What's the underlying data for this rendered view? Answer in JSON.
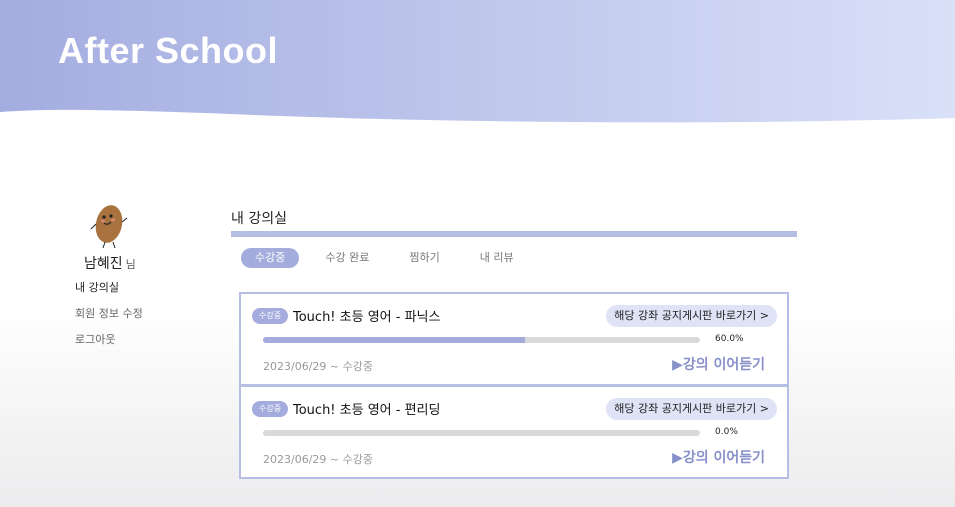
{
  "header": {
    "brand": "After School",
    "gradient_from": "#a4ade0",
    "gradient_to": "#d9e0f8"
  },
  "sidebar": {
    "avatar_icon": "potato-character-icon",
    "user_name": "남혜진",
    "user_suffix": "님",
    "menu": [
      {
        "label": "내 강의실",
        "active": true
      },
      {
        "label": "회원 정보 수정",
        "active": false
      },
      {
        "label": "로그아웃",
        "active": false
      }
    ]
  },
  "main": {
    "title": "내 강의실",
    "tabs": [
      {
        "label": "수강중",
        "active": true
      },
      {
        "label": "수강 완료",
        "active": false
      },
      {
        "label": "찜하기",
        "active": false
      },
      {
        "label": "내 리뷰",
        "active": false
      }
    ],
    "courses": [
      {
        "status": "수강중",
        "title": "Touch! 초등 영어 - 파닉스",
        "notice_link": "해당 강좌 공지게시판 바로가기 >",
        "progress": 60.0,
        "progress_text": "60.0%",
        "period": "2023/06/29 ~ 수강중",
        "resume_label": "▶강의 이어듣기"
      },
      {
        "status": "수강중",
        "title": "Touch! 초등 영어 - 편리딩",
        "notice_link": "해당 강좌 공지게시판 바로가기 >",
        "progress": 0.0,
        "progress_text": "0.0%",
        "period": "2023/06/29 ~ 수강중",
        "resume_label": "▶강의 이어듣기"
      }
    ]
  },
  "colors": {
    "accent": "#a3acdc",
    "accent_dark": "#8790c9",
    "card_border": "#b7bee3"
  }
}
